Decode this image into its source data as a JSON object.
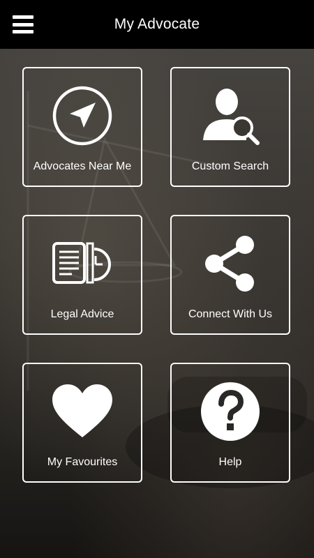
{
  "header": {
    "title": "My Advocate"
  },
  "tiles": [
    {
      "label": "Advocates Near Me",
      "icon": "navigation-arrow-icon"
    },
    {
      "label": "Custom Search",
      "icon": "user-search-icon"
    },
    {
      "label": "Legal Advice",
      "icon": "document-clock-icon"
    },
    {
      "label": "Connect With Us",
      "icon": "share-icon"
    },
    {
      "label": "My Favourites",
      "icon": "heart-icon"
    },
    {
      "label": "Help",
      "icon": "question-icon"
    }
  ],
  "colors": {
    "topbar": "#000000",
    "tile_border": "#ffffff",
    "text": "#ffffff"
  }
}
